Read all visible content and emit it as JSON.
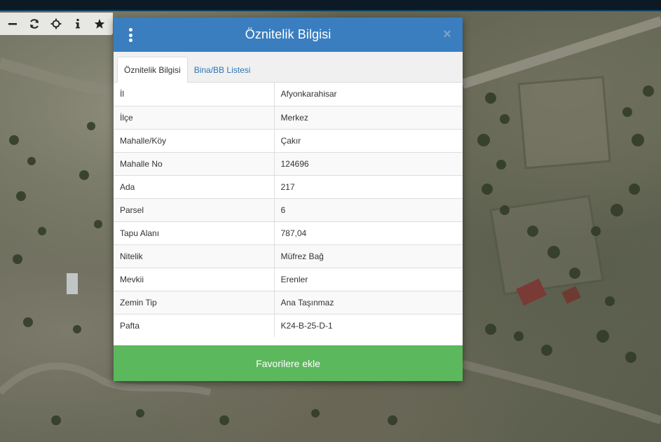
{
  "toolbar": {
    "tools": [
      "minus-icon",
      "refresh-icon",
      "crosshair-icon",
      "info-icon",
      "star-icon"
    ]
  },
  "modal": {
    "title": "Öznitelik Bilgisi",
    "close_label": "×",
    "tabs": [
      {
        "label": "Öznitelik Bilgisi",
        "active": true
      },
      {
        "label": "Bina/BB Listesi",
        "active": false
      }
    ],
    "rows": [
      {
        "key": "İl",
        "value": "Afyonkarahisar"
      },
      {
        "key": "İlçe",
        "value": "Merkez"
      },
      {
        "key": "Mahalle/Köy",
        "value": "Çakır"
      },
      {
        "key": "Mahalle No",
        "value": "124696"
      },
      {
        "key": "Ada",
        "value": "217"
      },
      {
        "key": "Parsel",
        "value": "6"
      },
      {
        "key": "Tapu Alanı",
        "value": "787,04"
      },
      {
        "key": "Nitelik",
        "value": "Müfrez Bağ"
      },
      {
        "key": "Mevkii",
        "value": "Erenler"
      },
      {
        "key": "Zemin Tip",
        "value": "Ana Taşınmaz"
      },
      {
        "key": "Pafta",
        "value": "K24-B-25-D-1"
      }
    ],
    "favorite_button_label": "Favorilere ekle"
  },
  "colors": {
    "header": "#3a7ebf",
    "favorite_button": "#5cb85c",
    "tab_link": "#2f74b5"
  }
}
